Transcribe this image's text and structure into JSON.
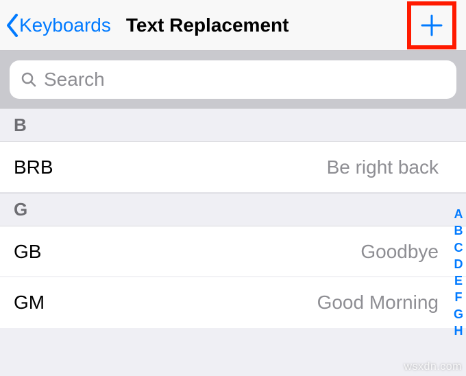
{
  "nav": {
    "back_label": "Keyboards",
    "title": "Text Replacement"
  },
  "search": {
    "placeholder": "Search"
  },
  "sections": [
    {
      "letter": "B",
      "rows": [
        {
          "shortcut": "BRB",
          "phrase": "Be right back"
        }
      ]
    },
    {
      "letter": "G",
      "rows": [
        {
          "shortcut": "GB",
          "phrase": "Goodbye"
        },
        {
          "shortcut": "GM",
          "phrase": "Good Morning"
        }
      ]
    }
  ],
  "index": [
    "A",
    "B",
    "C",
    "D",
    "E",
    "F",
    "G",
    "H"
  ],
  "watermark": "wsxdn.com",
  "colors": {
    "accent": "#007aff",
    "highlight_border": "#ff1a00"
  }
}
